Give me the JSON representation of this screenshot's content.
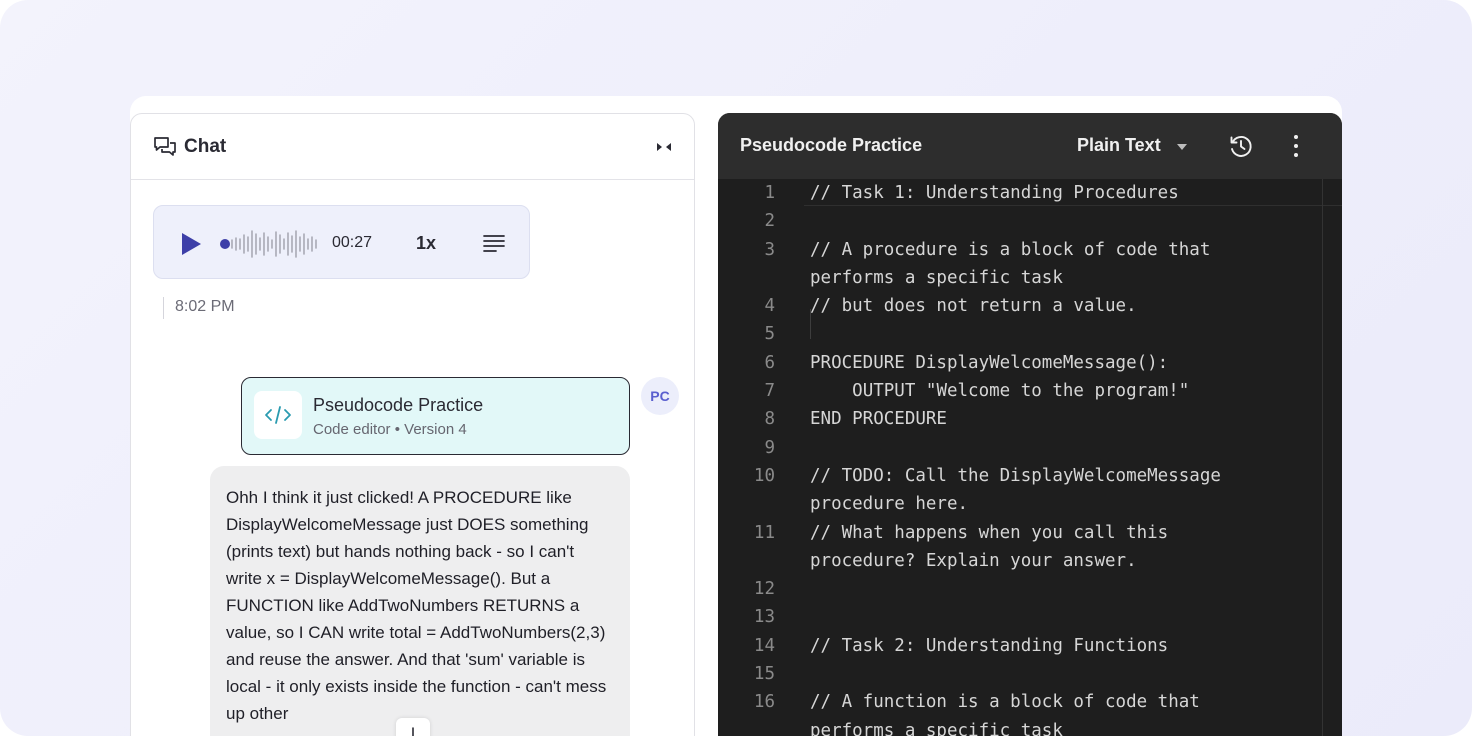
{
  "chat": {
    "title": "Chat",
    "audio": {
      "duration": "00:27",
      "speed": "1x"
    },
    "timestamp": "8:02 PM",
    "attachment": {
      "title": "Pseudocode Practice",
      "subtitle": "Code editor • Version 4"
    },
    "avatar_initials": "PC",
    "message": "Ohh I think it just clicked! A PROCEDURE like DisplayWelcomeMessage just DOES something (prints text) but hands nothing back - so I can't write x = DisplayWelcomeMessage(). But a FUNCTION like AddTwoNumbers RETURNS a value, so I CAN write total = AddTwoNumbers(2,3) and reuse the answer. And that 'sum' variable is local - it only exists inside the function - can't mess up other"
  },
  "editor": {
    "title": "Pseudocode Practice",
    "language": "Plain Text",
    "lines": [
      {
        "n": "1",
        "text": "// Task 1: Understanding Procedures"
      },
      {
        "n": "2",
        "text": ""
      },
      {
        "n": "3",
        "text": "// A procedure is a block of code that performs a specific task"
      },
      {
        "n": "4",
        "text": "// but does not return a value."
      },
      {
        "n": "5",
        "text": ""
      },
      {
        "n": "6",
        "text": "PROCEDURE DisplayWelcomeMessage():"
      },
      {
        "n": "7",
        "text": "    OUTPUT \"Welcome to the program!\""
      },
      {
        "n": "8",
        "text": "END PROCEDURE"
      },
      {
        "n": "9",
        "text": ""
      },
      {
        "n": "10",
        "text": "// TODO: Call the DisplayWelcomeMessage procedure here."
      },
      {
        "n": "11",
        "text": "// What happens when you call this procedure? Explain your answer."
      },
      {
        "n": "12",
        "text": ""
      },
      {
        "n": "13",
        "text": ""
      },
      {
        "n": "14",
        "text": "// Task 2: Understanding Functions"
      },
      {
        "n": "15",
        "text": ""
      },
      {
        "n": "16",
        "text": "// A function is a block of code that performs a specific task"
      }
    ]
  },
  "icons": {
    "chat": "chat-bubbles-icon",
    "collapse": "collapse-arrows-icon",
    "play": "play-icon",
    "transcript": "transcript-lines-icon",
    "code": "code-brackets-icon",
    "caret": "caret-down-icon",
    "history": "history-icon",
    "more": "more-vertical-icon",
    "scroll": "arrow-down-icon"
  },
  "colors": {
    "accent": "#3d3fa8",
    "attachment_bg": "#e2f8f8",
    "editor_bg": "#1e1e1e",
    "editor_header": "#2d2d2d"
  }
}
